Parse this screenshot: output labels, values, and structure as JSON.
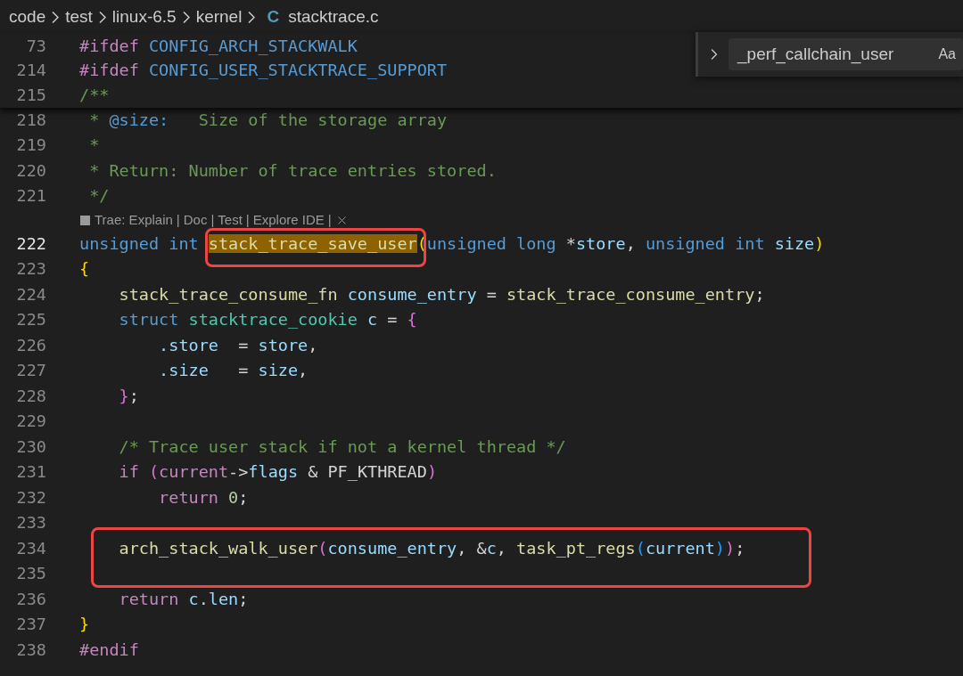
{
  "breadcrumb": {
    "items": [
      {
        "label": "code"
      },
      {
        "label": "test"
      },
      {
        "label": "linux-6.5"
      },
      {
        "label": "kernel"
      },
      {
        "label": "stacktrace.c",
        "icon_text": "C"
      }
    ]
  },
  "find_widget": {
    "value": "_perf_callchain_user",
    "case_button": "Aa"
  },
  "sticky_lines": [
    {
      "number": "73",
      "tokens": [
        {
          "text": "#ifdef ",
          "kind": "pp"
        },
        {
          "text": "CONFIG_ARCH_STACKWALK",
          "kind": "macro"
        }
      ]
    },
    {
      "number": "214",
      "tokens": [
        {
          "text": "#ifdef ",
          "kind": "pp"
        },
        {
          "text": "CONFIG_USER_STACKTRACE_SUPPORT",
          "kind": "macro"
        }
      ]
    },
    {
      "number": "215",
      "tokens": [
        {
          "text": "/**",
          "kind": "comment"
        }
      ]
    }
  ],
  "lines": [
    {
      "number": "218",
      "current": false,
      "boxed": false,
      "tokens": [
        {
          "text": " * ",
          "kind": "comment"
        },
        {
          "text": "@size:",
          "kind": "doctag"
        },
        {
          "text": "   Size of the storage array",
          "kind": "comment"
        }
      ]
    },
    {
      "number": "219",
      "current": false,
      "boxed": false,
      "tokens": [
        {
          "text": " *",
          "kind": "comment"
        }
      ]
    },
    {
      "number": "220",
      "current": false,
      "boxed": false,
      "tokens": [
        {
          "text": " * Return: Number of trace entries stored.",
          "kind": "comment"
        }
      ]
    },
    {
      "number": "221",
      "current": false,
      "boxed": false,
      "tokens": [
        {
          "text": " */",
          "kind": "comment"
        }
      ]
    },
    {
      "kind": "codelens",
      "items": [
        "Trae: Explain",
        "Doc",
        "Test",
        "Explore IDE"
      ],
      "separator": "|"
    },
    {
      "number": "222",
      "current": true,
      "boxed": false,
      "tokens": [
        {
          "text": "unsigned int ",
          "kind": "kw"
        },
        {
          "text": "stack_trace_save_user",
          "kind": "fn",
          "highlight": true,
          "boxed": true
        },
        {
          "text": "(",
          "kind": "b1"
        },
        {
          "text": "unsigned long ",
          "kind": "kw"
        },
        {
          "text": "*",
          "kind": "plain"
        },
        {
          "text": "store",
          "kind": "var"
        },
        {
          "text": ", ",
          "kind": "plain"
        },
        {
          "text": "unsigned int ",
          "kind": "kw"
        },
        {
          "text": "size",
          "kind": "var"
        },
        {
          "text": ")",
          "kind": "b1"
        }
      ]
    },
    {
      "number": "223",
      "current": false,
      "boxed": false,
      "tokens": [
        {
          "text": "{",
          "kind": "b1"
        }
      ]
    },
    {
      "number": "224",
      "current": false,
      "boxed": false,
      "tokens": [
        {
          "text": "    stack_trace_consume_fn ",
          "kind": "fn"
        },
        {
          "text": "consume_entry",
          "kind": "var"
        },
        {
          "text": " = ",
          "kind": "plain"
        },
        {
          "text": "stack_trace_consume_entry",
          "kind": "fn"
        },
        {
          "text": ";",
          "kind": "plain"
        }
      ]
    },
    {
      "number": "225",
      "current": false,
      "boxed": false,
      "tokens": [
        {
          "text": "    struct ",
          "kind": "kw"
        },
        {
          "text": "stacktrace_cookie ",
          "kind": "type"
        },
        {
          "text": "c",
          "kind": "var"
        },
        {
          "text": " = ",
          "kind": "plain"
        },
        {
          "text": "{",
          "kind": "b2"
        }
      ]
    },
    {
      "number": "226",
      "current": false,
      "boxed": false,
      "tokens": [
        {
          "text": "        .store",
          "kind": "var"
        },
        {
          "text": "  = ",
          "kind": "plain"
        },
        {
          "text": "store",
          "kind": "var"
        },
        {
          "text": ",",
          "kind": "plain"
        }
      ]
    },
    {
      "number": "227",
      "current": false,
      "boxed": false,
      "tokens": [
        {
          "text": "        .size",
          "kind": "var"
        },
        {
          "text": "   = ",
          "kind": "plain"
        },
        {
          "text": "size",
          "kind": "var"
        },
        {
          "text": ",",
          "kind": "plain"
        }
      ]
    },
    {
      "number": "228",
      "current": false,
      "boxed": false,
      "tokens": [
        {
          "text": "    }",
          "kind": "b2"
        },
        {
          "text": ";",
          "kind": "plain"
        }
      ]
    },
    {
      "number": "229",
      "current": false
    },
    {
      "number": "230",
      "current": false,
      "boxed": false,
      "tokens": [
        {
          "text": "    /* Trace user stack if not a kernel thread */",
          "kind": "comment"
        }
      ]
    },
    {
      "number": "231",
      "current": false,
      "boxed": false,
      "tokens": [
        {
          "text": "    if ",
          "kind": "pp"
        },
        {
          "text": "(",
          "kind": "b2"
        },
        {
          "text": "current",
          "kind": "pp"
        },
        {
          "text": "->",
          "kind": "plain"
        },
        {
          "text": "flags",
          "kind": "var"
        },
        {
          "text": " & ",
          "kind": "plain"
        },
        {
          "text": "PF_KTHREAD",
          "kind": "plain"
        },
        {
          "text": ")",
          "kind": "b2"
        }
      ]
    },
    {
      "number": "232",
      "current": false,
      "boxed": false,
      "tokens": [
        {
          "text": "        return ",
          "kind": "pp"
        },
        {
          "text": "0",
          "kind": "num"
        },
        {
          "text": ";",
          "kind": "plain"
        }
      ]
    },
    {
      "number": "233",
      "current": false
    },
    {
      "number": "234",
      "current": false,
      "boxed": true,
      "tokens": [
        {
          "text": "    arch_stack_walk_user",
          "kind": "fn"
        },
        {
          "text": "(",
          "kind": "b2"
        },
        {
          "text": "consume_entry",
          "kind": "var"
        },
        {
          "text": ", &",
          "kind": "plain"
        },
        {
          "text": "c",
          "kind": "var"
        },
        {
          "text": ", ",
          "kind": "plain"
        },
        {
          "text": "task_pt_regs",
          "kind": "fn"
        },
        {
          "text": "(",
          "kind": "b3"
        },
        {
          "text": "current",
          "kind": "var"
        },
        {
          "text": ")",
          "kind": "b3"
        },
        {
          "text": ")",
          "kind": "b2"
        },
        {
          "text": ";",
          "kind": "plain"
        }
      ]
    },
    {
      "number": "235",
      "current": false,
      "boxed": true
    },
    {
      "number": "236",
      "current": false,
      "boxed": false,
      "tokens": [
        {
          "text": "    return ",
          "kind": "pp"
        },
        {
          "text": "c",
          "kind": "var"
        },
        {
          "text": ".",
          "kind": "plain"
        },
        {
          "text": "len",
          "kind": "var"
        },
        {
          "text": ";",
          "kind": "plain"
        }
      ]
    },
    {
      "number": "237",
      "current": false,
      "boxed": false,
      "tokens": [
        {
          "text": "}",
          "kind": "b1"
        }
      ]
    },
    {
      "number": "238",
      "current": false,
      "tokens": [
        {
          "text": "#endif",
          "kind": "pp"
        }
      ]
    }
  ]
}
